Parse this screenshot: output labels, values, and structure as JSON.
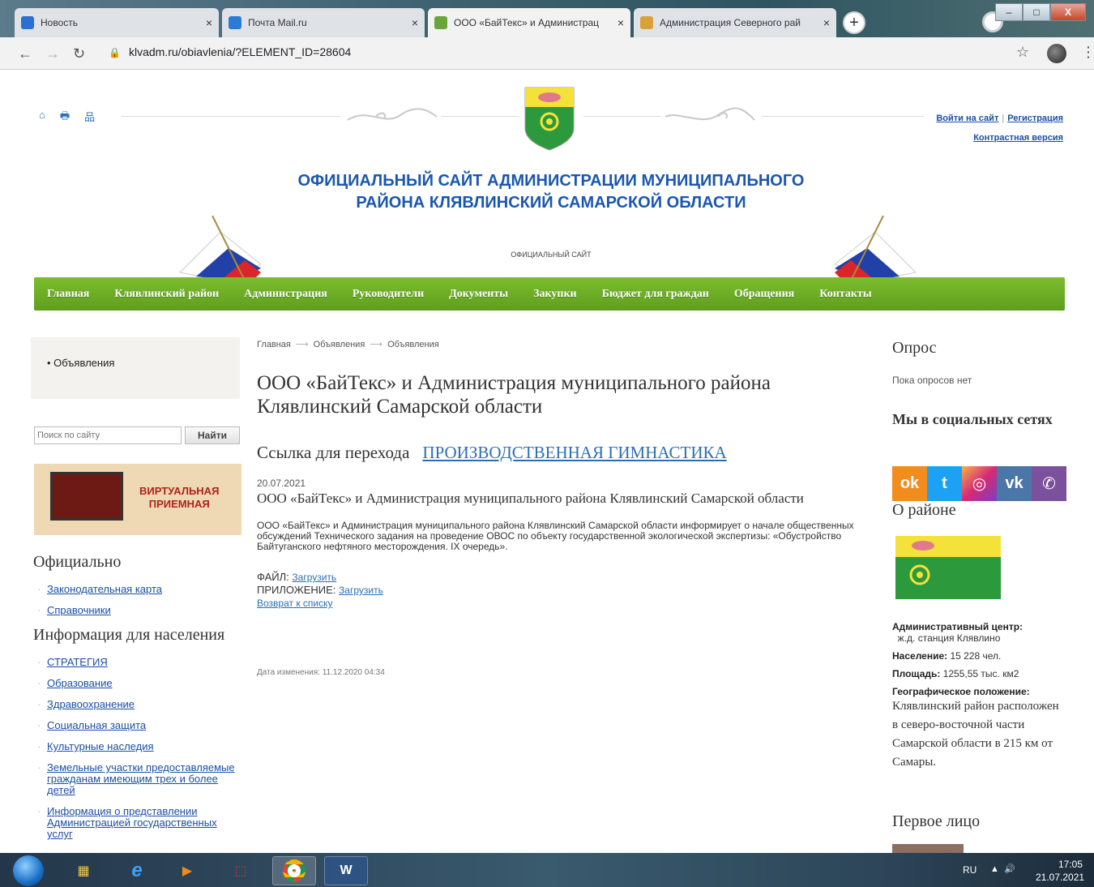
{
  "browser": {
    "tabs": [
      {
        "title": "Новость",
        "favicon_color": "#2b6fd0",
        "active": false
      },
      {
        "title": "Почта Mail.ru",
        "favicon_color": "#2a7ad6",
        "active": false
      },
      {
        "title": "ООО «БайТекс» и Администрац",
        "favicon_color": "#6aa53a",
        "active": true
      },
      {
        "title": "Администрация Северного рай",
        "favicon_color": "#d8a13a",
        "active": false
      }
    ],
    "close_glyph": "×",
    "new_tab_glyph": "+",
    "url": "klvadm.ru/obiavlenia/?ELEMENT_ID=28604",
    "icons": [
      "back-icon",
      "forward-icon",
      "reload-icon",
      "lock-icon",
      "star-icon",
      "menu-icon"
    ]
  },
  "header": {
    "top_icons": [
      "⌂",
      "🖶",
      "品"
    ],
    "login_label": "Войти на сайт",
    "register_label": "Регистрация",
    "contrast_label": "Контрастная версия",
    "title": "ОФИЦИАЛЬНЫЙ САЙТ АДМИНИСТРАЦИИ МУНИЦИПАЛЬНОГО РАЙОНА КЛЯВЛИНСКИЙ САМАРСКОЙ ОБЛАСТИ",
    "subtitle": "ОФИЦИАЛЬНЫЙ САЙТ"
  },
  "mainnav": [
    "Главная",
    "Клявлинский район",
    "Администрация",
    "Руководители",
    "Документы",
    "Закупки",
    "Бюджет для граждан",
    "Обращения",
    "Контакты"
  ],
  "left": {
    "nav_item": "Объявления",
    "search_placeholder": "Поиск по сайту",
    "search_button": "Найти",
    "banner_line1": "ВИРТУАЛЬНАЯ",
    "banner_line2": "ПРИЕМНАЯ",
    "official_heading": "Официально",
    "official_links": [
      "Законодательная карта",
      "Справочники"
    ],
    "info_heading": "Информация для населения",
    "info_links": [
      "СТРАТЕГИЯ",
      "Образование",
      "Здравоохранение",
      "Социальная защита",
      "Культурные наследия",
      "Земельные участки предоставляемые гражданам имеющим трех и более детей",
      "Информация о представлении Администрацией государственных услуг"
    ]
  },
  "content": {
    "breadcrumbs": [
      "Главная",
      "Объявления",
      "Объявления"
    ],
    "title": "ООО «БайТекс» и Администрация муниципального района Клявлинский Самарской области",
    "link_prefix": "Ссылка для перехода",
    "link_text": "ПРОИЗВОДСТВЕННАЯ ГИМНАСТИКА",
    "date": "20.07.2021",
    "subtitle": "ООО «БайТекс» и Администрация муниципального района Клявлинский Самарской области",
    "body": "ООО «БайТекс» и Администрация муниципального района Клявлинский Самарской области информирует о начале общественных обсуждений Технического задания на проведение ОВОС по объекту государственной экологической экспертизы: «Обустройство Байтуганского нефтяного месторождения. IX очередь».",
    "file_label": "ФАЙЛ:",
    "file_link": "Загрузить",
    "attachment_label": "ПРИЛОЖЕНИЕ:",
    "attachment_link": "Загрузить",
    "back_link": "Возврат к списку",
    "changed": "Дата изменения: 11.12.2020 04:34"
  },
  "right": {
    "poll_heading": "Опрос",
    "poll_text": "Пока опросов нет",
    "social_heading": "Мы в социальных сетях",
    "social": [
      {
        "name": "odnoklassniki",
        "glyph": "ok",
        "color": "#f28c1d"
      },
      {
        "name": "twitter",
        "glyph": "t",
        "color": "#1da1f2"
      },
      {
        "name": "instagram",
        "glyph": "◎",
        "color": "#d62976"
      },
      {
        "name": "vk",
        "glyph": "vk",
        "color": "#4a76a8"
      },
      {
        "name": "viber",
        "glyph": "✆",
        "color": "#7b519d"
      }
    ],
    "about_heading": "О районе",
    "admin_center_label": "Административный центр:",
    "admin_center_value": "ж.д. станция Клявлино",
    "population_label": "Население:",
    "population_value": "15 228 чел.",
    "area_label": "Площадь:",
    "area_value": "1255,55 тыс. км2",
    "geo_label": "Географическое положение:",
    "geo_value": "Клявлинский район расположен в северо-восточной части Самарской области в 215 км от Самары.",
    "first_face_heading": "Первое лицо"
  },
  "taskbar": {
    "apps": [
      "explorer",
      "ie",
      "media",
      "pdf",
      "chrome",
      "word"
    ],
    "lang": "RU",
    "time": "17:05",
    "date": "21.07.2021"
  }
}
